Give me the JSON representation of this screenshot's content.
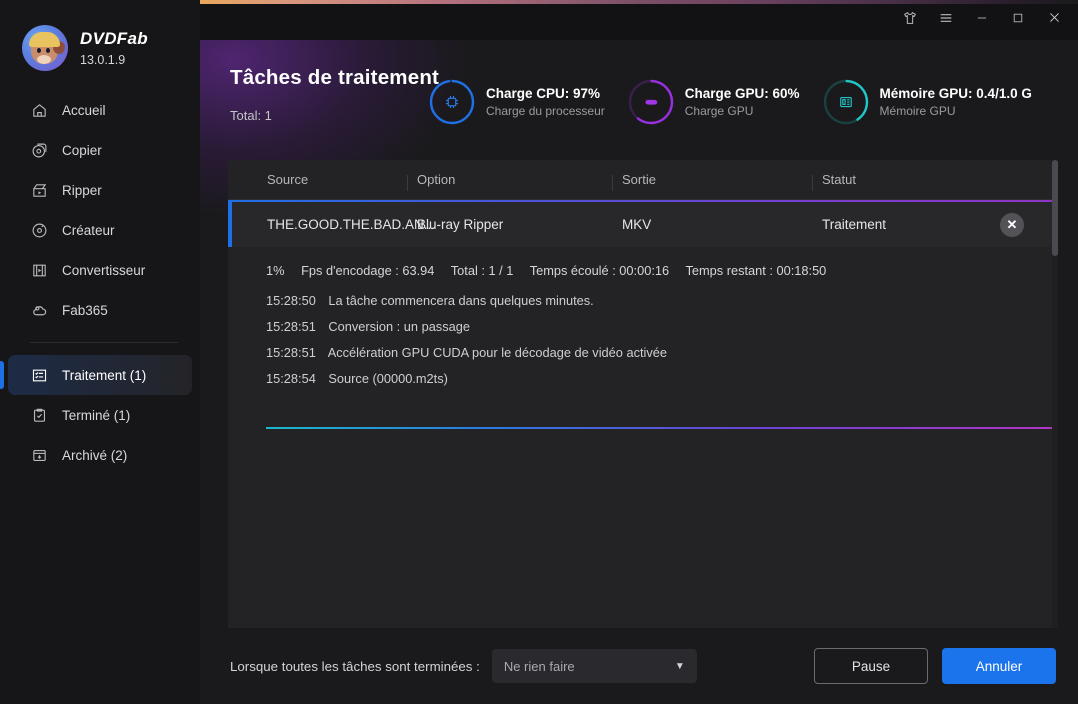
{
  "brand": {
    "name": "DVDFab",
    "version": "13.0.1.9",
    "logo_icon": "monkey-avatar-icon"
  },
  "titlebar": {
    "buttons": [
      {
        "name": "theme-button",
        "icon": "tshirt-icon"
      },
      {
        "name": "menu-button",
        "icon": "hamburger-icon"
      },
      {
        "name": "minimize-button",
        "icon": "minimize-icon"
      },
      {
        "name": "maximize-button",
        "icon": "maximize-icon"
      },
      {
        "name": "close-button",
        "icon": "close-icon"
      }
    ]
  },
  "sidebar": {
    "items": [
      {
        "label": "Accueil",
        "icon": "home-icon",
        "active": false
      },
      {
        "label": "Copier",
        "icon": "disc-copy-icon",
        "active": false
      },
      {
        "label": "Ripper",
        "icon": "disc-rip-icon",
        "active": false
      },
      {
        "label": "Créateur",
        "icon": "disc-create-icon",
        "active": false
      },
      {
        "label": "Convertisseur",
        "icon": "film-convert-icon",
        "active": false
      },
      {
        "label": "Fab365",
        "icon": "cloud-365-icon",
        "active": false
      }
    ],
    "items2": [
      {
        "label": "Traitement (1)",
        "icon": "task-list-icon",
        "active": true
      },
      {
        "label": "Terminé (1)",
        "icon": "clipboard-check-icon",
        "active": false
      },
      {
        "label": "Archivé (2)",
        "icon": "archive-box-icon",
        "active": false
      }
    ]
  },
  "header": {
    "title": "Tâches de traitement",
    "total": "Total: 1",
    "gauges": [
      {
        "main": "Charge CPU: 97%",
        "sub": "Charge du processeur",
        "icon": "cpu-chip-icon",
        "color": "#1f6fe5",
        "percent": 97
      },
      {
        "main": "Charge GPU: 60%",
        "sub": "Charge GPU",
        "icon": "nvidia-gpu-icon",
        "color": "#9a2fe0",
        "percent": 60
      },
      {
        "main": "Mémoire GPU: 0.4/1.0 G",
        "sub": "Mémoire GPU",
        "icon": "gpu-memory-icon",
        "color": "#21c7c7",
        "percent": 40
      }
    ]
  },
  "table": {
    "columns": [
      "Source",
      "Option",
      "Sortie",
      "Statut"
    ],
    "row": {
      "source": "THE.GOOD.THE.BAD.AN...",
      "option": "Blu-ray Ripper",
      "sortie": "MKV",
      "statut": "Traitement",
      "close_icon": "cancel-task-icon"
    },
    "detail": {
      "stats": [
        "1%",
        "Fps d'encodage : 63.94",
        "Total : 1 / 1",
        "Temps écoulé : 00:00:16",
        "Temps restant : 00:18:50"
      ],
      "logs": [
        {
          "time": "15:28:50",
          "text": "La tâche commencera dans quelques minutes."
        },
        {
          "time": "15:28:51",
          "text": "Conversion : un passage"
        },
        {
          "time": "15:28:51",
          "text": "Accélération GPU CUDA pour le décodage de vidéo activée"
        },
        {
          "time": "15:28:54",
          "text": "Source (00000.m2ts)"
        }
      ]
    }
  },
  "footer": {
    "label": "Lorsque toutes les tâches sont terminées :",
    "select_value": "Ne rien faire",
    "pause_label": "Pause",
    "cancel_label": "Annuler"
  },
  "colors": {
    "accent_blue": "#1b74ec",
    "cpu_ring": "#1f6fe5",
    "gpu_ring": "#9a2fe0",
    "mem_ring": "#21c7c7",
    "panel_bg": "#232326",
    "sidebar_bg": "#161618"
  }
}
